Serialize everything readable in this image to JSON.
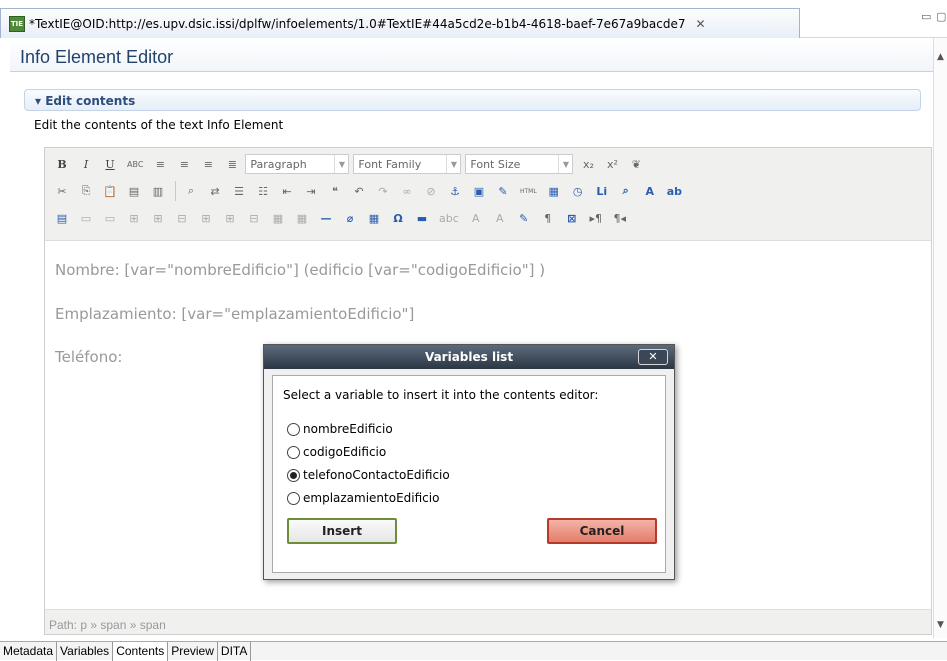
{
  "tab": {
    "title": "*TextIE@OID:http://es.upv.dsic.issi/dplfw/infoelements/1.0#TextIE#44a5cd2e-b1b4-4618-baef-7e67a9bacde7",
    "close_glyph": "✕",
    "icon_text": "TIE"
  },
  "editor": {
    "title": "Info Element Editor"
  },
  "section": {
    "title": "Edit contents",
    "description": "Edit the contents of the text Info Element"
  },
  "toolbar": {
    "paragraph": "Paragraph",
    "font_family": "Font Family",
    "font_size": "Font Size",
    "bold": "B",
    "italic": "I",
    "underline": "U",
    "strike": "ABC",
    "subscript": "x₂",
    "superscript": "x²",
    "html": "HTML",
    "omega": "Ω",
    "pilcrow": "¶"
  },
  "content": {
    "line1": "Nombre: [var=\"nombreEdificio\"] (edificio [var=\"codigoEdificio\"] )",
    "line2": "Emplazamiento: [var=\"emplazamientoEdificio\"]",
    "line3": "Teléfono:",
    "path": "Path: p » span » span"
  },
  "dialog": {
    "title": "Variables list",
    "close": "✕",
    "prompt": "Select a variable to insert it into the contents editor:",
    "options": [
      {
        "label": "nombreEdificio",
        "selected": false
      },
      {
        "label": "codigoEdificio",
        "selected": false
      },
      {
        "label": "telefonoContactoEdificio",
        "selected": true
      },
      {
        "label": "emplazamientoEdificio",
        "selected": false
      }
    ],
    "insert": "Insert",
    "cancel": "Cancel"
  },
  "bottom_tabs": [
    "Metadata",
    "Variables",
    "Contents",
    "Preview",
    "DITA"
  ],
  "active_bottom_tab": "Contents"
}
